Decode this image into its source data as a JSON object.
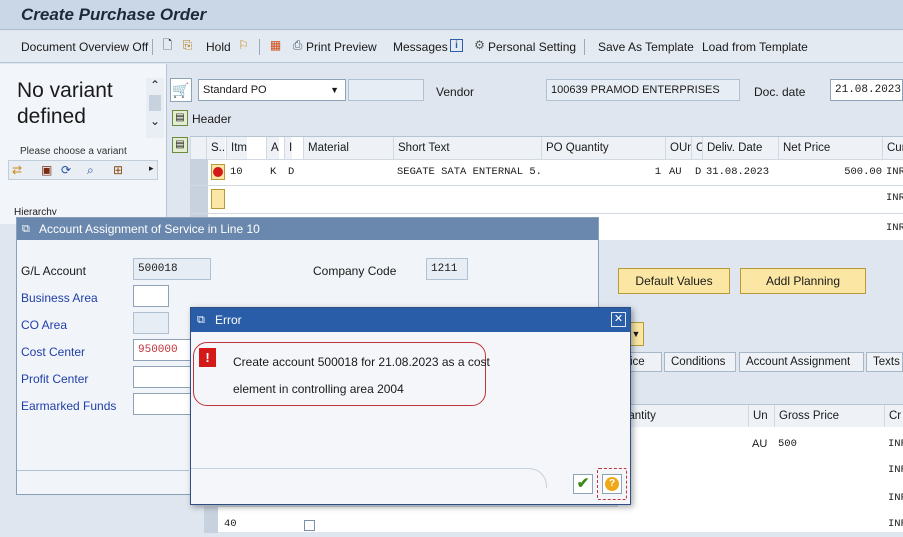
{
  "title": "Create Purchase Order",
  "toolbar": {
    "doc_overview": "Document Overview Off",
    "hold": "Hold",
    "print_preview": "Print Preview",
    "messages": "Messages",
    "personal_setting": "Personal Setting",
    "save_template": "Save As Template",
    "load_template": "Load from Template"
  },
  "left": {
    "variant": "No variant defined",
    "choose": "Please choose a variant",
    "hierarchy": "Hierarchy"
  },
  "header": {
    "po_type": "Standard PO",
    "vendor_label": "Vendor",
    "vendor_value": "100639 PRAMOD ENTERPRISES",
    "docdate_label": "Doc. date",
    "docdate_value": "21.08.2023",
    "header_label": "Header"
  },
  "grid": {
    "headers": [
      "S..",
      "Itm",
      "A",
      "I",
      "Material",
      "Short Text",
      "PO Quantity",
      "OUn",
      "C",
      "Deliv. Date",
      "Net Price",
      "Cur"
    ],
    "row1": {
      "itm": "10",
      "a": "K",
      "i": "D",
      "short_text": "SEGATE SATA ENTERNAL 5..",
      "qty": "1",
      "oun": "AU",
      "c": "D",
      "deliv": "31.08.2023",
      "price": "500.00",
      "cur": "INR"
    },
    "row2_cur": "INR",
    "row3_cur": "INR"
  },
  "buttons": {
    "default_values": "Default Values",
    "addl_planning": "Addl Planning"
  },
  "tabs": [
    "ice",
    "Conditions",
    "Account Assignment",
    "Texts"
  ],
  "lower_grid": {
    "h_quantity": "uantity",
    "h_un": "Un",
    "h_gross": "Gross Price",
    "h_cur": "Cr",
    "row_un": "AU",
    "row_gross": "500",
    "curs": [
      "INR",
      "INR",
      "INR",
      "INR",
      "INR"
    ],
    "item40": "40"
  },
  "acct_dialog": {
    "title": "Account Assignment of Service in Line 10",
    "gl_label": "G/L Account",
    "gl_value": "500018",
    "company_label": "Company Code",
    "company_value": "1211",
    "business_area": "Business Area",
    "co_area": "CO Area",
    "cost_center": "Cost Center",
    "cost_center_value": "950000",
    "profit_center": "Profit Center",
    "earmarked": "Earmarked Funds"
  },
  "error_dialog": {
    "title": "Error",
    "line1": "Create account 500018 for 21.08.2023 as a cost",
    "line2": "element in controlling area 2004"
  },
  "colors": {
    "error_border": "#c0343a",
    "dialog_title": "#2a5da8",
    "button_fill": "#fbe7a3"
  }
}
